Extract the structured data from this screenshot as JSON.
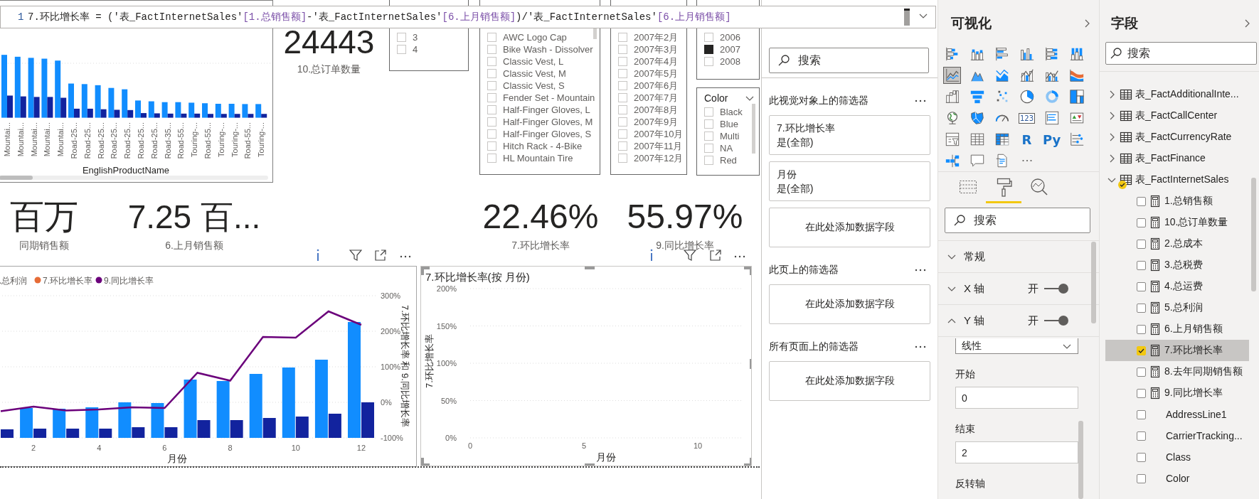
{
  "formula_bar": {
    "line_number": "1",
    "segments": [
      {
        "kind": "code",
        "text": "7.环比增长率 = ('表_FactInternetSales'"
      },
      {
        "kind": "ref",
        "text": "[1.总销售额]"
      },
      {
        "kind": "code",
        "text": "-'表_FactInternetSales'"
      },
      {
        "kind": "ref",
        "text": "[6.上月销售额]"
      },
      {
        "kind": "code",
        "text": ")/'表_FactInternetSales'"
      },
      {
        "kind": "ref",
        "text": "[6.上月销售额]"
      }
    ]
  },
  "product_chart": {
    "x_labels": [
      "Mountai...",
      "Mountai...",
      "Mountai...",
      "Mountai...",
      "Mountai...",
      "Road-25...",
      "Road-25...",
      "Road-25...",
      "Road-25...",
      "Road-25...",
      "Road-25...",
      "Road-25...",
      "Road-35...",
      "Road-55...",
      "Touring-...",
      "Road-55...",
      "Touring-...",
      "Touring-...",
      "Road-55...",
      "Touring-..."
    ],
    "axis_title": "EnglishProductName"
  },
  "cards": [
    {
      "value": "24443",
      "label": "10.总订单数量"
    },
    {
      "value": "百万",
      "label": "同期销售额"
    },
    {
      "value": "7.25 百...",
      "label": "6.上月销售额"
    },
    {
      "value": "22.46%",
      "label": "7.环比增长率"
    },
    {
      "value": "55.97%",
      "label": "9.同比增长率"
    }
  ],
  "slicers": [
    {
      "items": [
        {
          "label": "3",
          "checked": false
        },
        {
          "label": "4",
          "checked": false
        }
      ]
    },
    {
      "items": [
        {
          "label": "AWC Logo Cap",
          "checked": false
        },
        {
          "label": "Bike Wash - Dissolver",
          "checked": false
        },
        {
          "label": "Classic Vest, L",
          "checked": false
        },
        {
          "label": "Classic Vest, M",
          "checked": false
        },
        {
          "label": "Classic Vest, S",
          "checked": false
        },
        {
          "label": "Fender Set - Mountain",
          "checked": false
        },
        {
          "label": "Half-Finger Gloves, L",
          "checked": false
        },
        {
          "label": "Half-Finger Gloves, M",
          "checked": false
        },
        {
          "label": "Half-Finger Gloves, S",
          "checked": false
        },
        {
          "label": "Hitch Rack - 4-Bike",
          "checked": false
        },
        {
          "label": "HL Mountain Tire",
          "checked": false
        }
      ]
    },
    {
      "items": [
        {
          "label": "2007年2月",
          "checked": false
        },
        {
          "label": "2007年3月",
          "checked": false
        },
        {
          "label": "2007年4月",
          "checked": false
        },
        {
          "label": "2007年5月",
          "checked": false
        },
        {
          "label": "2007年6月",
          "checked": false
        },
        {
          "label": "2007年7月",
          "checked": false
        },
        {
          "label": "2007年8月",
          "checked": false
        },
        {
          "label": "2007年9月",
          "checked": false
        },
        {
          "label": "2007年10月",
          "checked": false
        },
        {
          "label": "2007年11月",
          "checked": false
        },
        {
          "label": "2007年12月",
          "checked": false
        }
      ]
    },
    {
      "items": [
        {
          "label": "2006",
          "checked": false
        },
        {
          "label": "2007",
          "checked": true
        },
        {
          "label": "2008",
          "checked": false
        }
      ]
    },
    {
      "title": "Color",
      "items": [
        {
          "label": "Black",
          "checked": false
        },
        {
          "label": "Blue",
          "checked": false
        },
        {
          "label": "Multi",
          "checked": false
        },
        {
          "label": "NA",
          "checked": false
        },
        {
          "label": "Red",
          "checked": false
        }
      ]
    }
  ],
  "combo_chart": {
    "legend": [
      {
        "label": ".总利润"
      },
      {
        "label": "7.环比增长率",
        "color": "#e66c37"
      }
    ],
    "chart_data": {
      "type": "line",
      "grid": true,
      "xlim": [
        1,
        12.5
      ],
      "ylim": [
        -1,
        3
      ],
      "xlabel": "月份",
      "ylabel": "7.环比增长率 和 9.同比增长率",
      "x": [
        1,
        2,
        3,
        4,
        5,
        6,
        7,
        8,
        9,
        10,
        11,
        12
      ],
      "xticks": [
        2,
        4,
        6,
        8,
        10,
        12
      ],
      "yticks": [
        {
          "value": -1,
          "label": "-100%"
        },
        {
          "value": 0,
          "label": "0%"
        },
        {
          "value": 1,
          "label": "100%"
        },
        {
          "value": 2,
          "label": "200%"
        },
        {
          "value": 3,
          "label": "300%"
        }
      ],
      "series": [
        {
          "name": "9.同比增长率",
          "color": "#6b007b",
          "values": [
            -0.25,
            -0.12,
            -0.23,
            -0.2,
            -0.14,
            -0.16,
            0.83,
            0.61,
            1.84,
            1.82,
            2.56,
            2.18
          ]
        }
      ]
    }
  },
  "line_chart": {
    "chart_data": {
      "type": "line",
      "grid": true,
      "xlim": [
        0,
        12
      ],
      "ylim": [
        0,
        2
      ],
      "title": "7.环比增长率(按 月份)",
      "xlabel": "月份",
      "ylabel": "7.环比增长率",
      "xticks": [
        0,
        5,
        10
      ],
      "yticks": [
        {
          "value": 0,
          "label": "0%"
        },
        {
          "value": 0.5,
          "label": "50%"
        },
        {
          "value": 1,
          "label": "100%"
        },
        {
          "value": 1.5,
          "label": "150%"
        },
        {
          "value": 2,
          "label": "200%"
        }
      ]
    }
  },
  "filters": {
    "search_placeholder": "搜索",
    "sections": [
      {
        "title": "此视觉对象上的筛选器",
        "cards": [
          {
            "kind": "filter",
            "name": "7.环比增长率",
            "value": "是(全部)"
          },
          {
            "kind": "filter",
            "name": "月份",
            "value": "是(全部)"
          },
          {
            "kind": "drop",
            "text": "在此处添加数据字段"
          }
        ]
      },
      {
        "title": "此页上的筛选器",
        "cards": [
          {
            "kind": "drop",
            "text": "在此处添加数据字段"
          }
        ]
      },
      {
        "title": "所有页面上的筛选器",
        "cards": [
          {
            "kind": "drop",
            "text": "在此处添加数据字段"
          }
        ]
      }
    ]
  },
  "visualizations": {
    "title": "可视化",
    "visual_types": [
      {
        "kind": "stacked-bar",
        "selected": false
      },
      {
        "kind": "stacked-column",
        "selected": false
      },
      {
        "kind": "clustered-bar",
        "selected": false
      },
      {
        "kind": "clustered-column",
        "selected": false
      },
      {
        "kind": "full-bar",
        "selected": false
      },
      {
        "kind": "full-column",
        "selected": false
      },
      {
        "kind": "line",
        "selected": true
      },
      {
        "kind": "area",
        "selected": false
      },
      {
        "kind": "stacked-area",
        "selected": false
      },
      {
        "kind": "line-column",
        "selected": false
      },
      {
        "kind": "line-clustered",
        "selected": false
      },
      {
        "kind": "ribbon",
        "selected": false
      },
      {
        "kind": "waterfall",
        "selected": false
      },
      {
        "kind": "funnel",
        "selected": false
      },
      {
        "kind": "scatter",
        "selected": false
      },
      {
        "kind": "pie",
        "selected": false
      },
      {
        "kind": "donut",
        "selected": false
      },
      {
        "kind": "treemap",
        "selected": false
      },
      {
        "kind": "map",
        "selected": false
      },
      {
        "kind": "filled-map",
        "selected": false
      },
      {
        "kind": "gauge",
        "selected": false
      },
      {
        "kind": "card",
        "selected": false,
        "glyph": "123"
      },
      {
        "kind": "multirow-card",
        "selected": false
      },
      {
        "kind": "kpi",
        "selected": false
      },
      {
        "kind": "slicer",
        "selected": false
      },
      {
        "kind": "table",
        "selected": false
      },
      {
        "kind": "matrix",
        "selected": false
      },
      {
        "kind": "r-script",
        "selected": false,
        "glyph": "R"
      },
      {
        "kind": "python",
        "selected": false,
        "glyph": "Py"
      },
      {
        "kind": "key-influencers",
        "selected": false
      },
      {
        "kind": "decomposition-tree",
        "selected": false
      },
      {
        "kind": "qa",
        "selected": false
      },
      {
        "kind": "paginated",
        "selected": false
      },
      {
        "kind": "more",
        "selected": false
      }
    ],
    "pane_tabs": [
      {
        "kind": "fields",
        "selected": false
      },
      {
        "kind": "format",
        "selected": true
      },
      {
        "kind": "analytics",
        "selected": false
      }
    ],
    "search_placeholder": "搜索",
    "sections": [
      {
        "label": "常规",
        "expanded": false
      },
      {
        "label": "X 轴",
        "expanded": false,
        "toggle": {
          "label": "开",
          "on": true
        }
      },
      {
        "label": "Y 轴",
        "expanded": true,
        "toggle": {
          "label": "开",
          "on": true
        }
      }
    ],
    "y_axis": {
      "scale_type": "线性",
      "start_label": "开始",
      "start_value": "0",
      "end_label": "结束",
      "end_value": "2",
      "invert_label": "反转轴"
    }
  },
  "fields": {
    "title": "字段",
    "search_placeholder": "搜索",
    "tables": [
      {
        "name": "表_FactAdditionalInte...",
        "expanded": false,
        "in_use": false
      },
      {
        "name": "表_FactCallCenter",
        "expanded": false,
        "in_use": false
      },
      {
        "name": "表_FactCurrencyRate",
        "expanded": false,
        "in_use": false
      },
      {
        "name": "表_FactFinance",
        "expanded": false,
        "in_use": false
      },
      {
        "name": "表_FactInternetSales",
        "expanded": true,
        "in_use": true,
        "children": [
          {
            "name": "1.总销售额",
            "kind": "measure",
            "checked": false,
            "selected": false
          },
          {
            "name": "10.总订单数量",
            "kind": "measure",
            "checked": false,
            "selected": false
          },
          {
            "name": "2.总成本",
            "kind": "measure",
            "checked": false,
            "selected": false
          },
          {
            "name": "3.总税费",
            "kind": "measure",
            "checked": false,
            "selected": false
          },
          {
            "name": "4.总运费",
            "kind": "measure",
            "checked": false,
            "selected": false
          },
          {
            "name": "5.总利润",
            "kind": "measure",
            "checked": false,
            "selected": false
          },
          {
            "name": "6.上月销售额",
            "kind": "measure",
            "checked": false,
            "selected": false
          },
          {
            "name": "7.环比增长率",
            "kind": "measure",
            "checked": true,
            "selected": true
          },
          {
            "name": "8.去年同期销售额",
            "kind": "measure",
            "checked": false,
            "selected": false
          },
          {
            "name": "9.同比增长率",
            "kind": "measure",
            "checked": false,
            "selected": false
          },
          {
            "name": "AddressLine1",
            "kind": "column",
            "checked": false,
            "selected": false
          },
          {
            "name": "CarrierTracking...",
            "kind": "column",
            "checked": false,
            "selected": false
          },
          {
            "name": "Class",
            "kind": "column",
            "checked": false,
            "selected": false
          },
          {
            "name": "Color",
            "kind": "column",
            "checked": false,
            "selected": false
          }
        ]
      }
    ]
  }
}
